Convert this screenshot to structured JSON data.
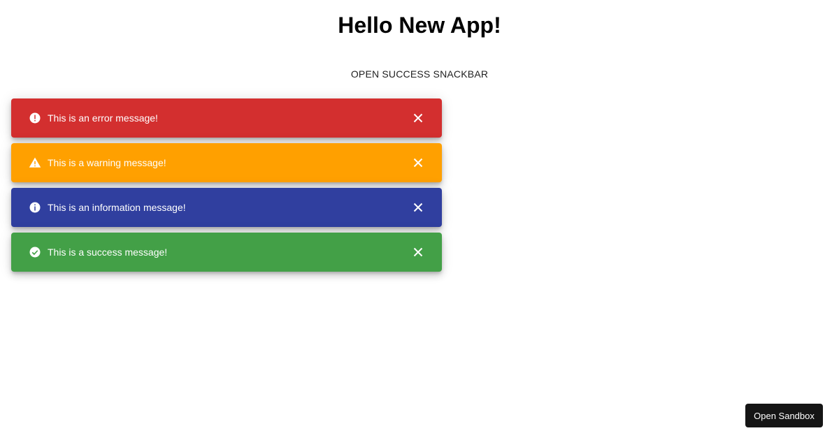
{
  "page": {
    "title": "Hello New App!",
    "open_button_label": "OPEN SUCCESS SNACKBAR",
    "sandbox_button_label": "Open Sandbox"
  },
  "snackbars": [
    {
      "type": "error",
      "message": "This is an error message!",
      "color": "#d32f2f",
      "icon": "error-icon"
    },
    {
      "type": "warning",
      "message": "This is a warning message!",
      "color": "#ffa000",
      "icon": "warning-icon"
    },
    {
      "type": "info",
      "message": "This is an information message!",
      "color": "#303f9f",
      "icon": "info-icon"
    },
    {
      "type": "success",
      "message": "This is a success message!",
      "color": "#43a047",
      "icon": "check-circle-icon"
    }
  ]
}
